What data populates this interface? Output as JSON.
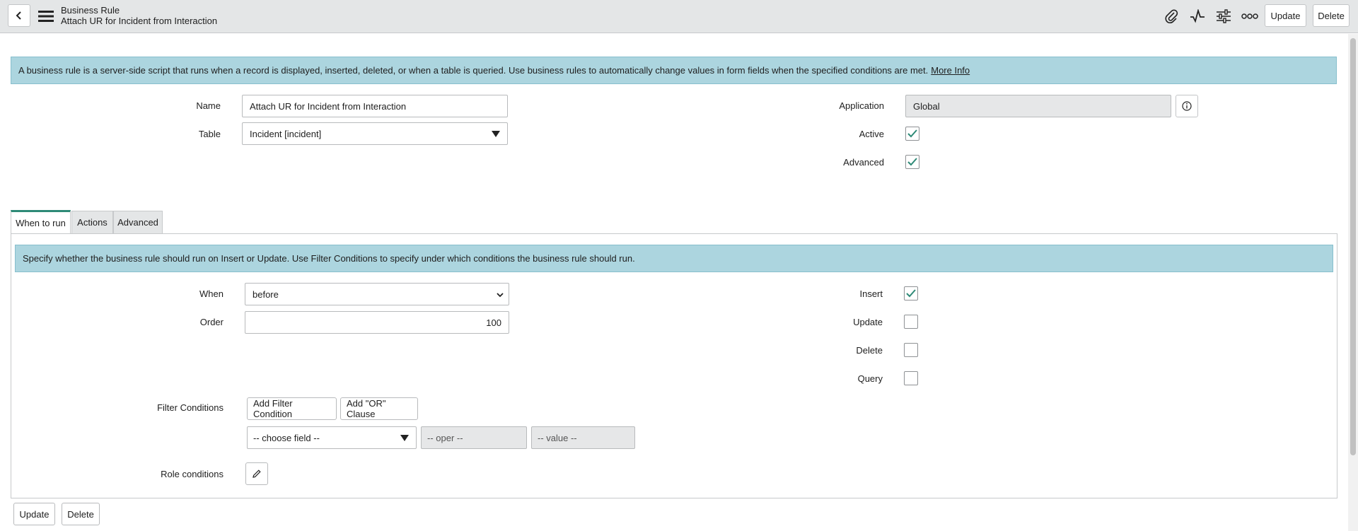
{
  "header": {
    "record_type": "Business Rule",
    "record_name": "Attach UR for Incident from Interaction",
    "update_label": "Update",
    "delete_label": "Delete",
    "icons": [
      "back-icon",
      "menu-icon",
      "paperclip-icon",
      "activity-icon",
      "sliders-icon",
      "more-icon"
    ]
  },
  "info_banner": {
    "text": "A business rule is a server-side script that runs when a record is displayed, inserted, deleted, or when a table is queried. Use business rules to automatically change values in form fields when the specified conditions are met.",
    "link": "More Info"
  },
  "form": {
    "name_label": "Name",
    "name_value": "Attach UR for Incident from Interaction",
    "table_label": "Table",
    "table_value": "Incident [incident]",
    "application_label": "Application",
    "application_value": "Global",
    "active_label": "Active",
    "active_checked": true,
    "advanced_label": "Advanced",
    "advanced_checked": true
  },
  "tabs": [
    {
      "label": "When to run",
      "active": true
    },
    {
      "label": "Actions",
      "active": false
    },
    {
      "label": "Advanced",
      "active": false
    }
  ],
  "when_to_run": {
    "banner": "Specify whether the business rule should run on Insert or Update. Use Filter Conditions to specify under which conditions the business rule should run.",
    "when_label": "When",
    "when_value": "before",
    "order_label": "Order",
    "order_value": "100",
    "insert_label": "Insert",
    "insert_checked": true,
    "update_label": "Update",
    "update_checked": false,
    "delete_label": "Delete",
    "delete_checked": false,
    "query_label": "Query",
    "query_checked": false,
    "filter_label": "Filter Conditions",
    "add_filter_label": "Add Filter Condition",
    "add_or_label": "Add \"OR\" Clause",
    "choose_field": "-- choose field --",
    "oper": "-- oper --",
    "value": "-- value --",
    "role_label": "Role conditions"
  },
  "footer": {
    "update_label": "Update",
    "delete_label": "Delete"
  },
  "colors": {
    "banner_bg": "#acd5df",
    "check": "#2e8a77",
    "header_bg": "#e4e6e7"
  }
}
